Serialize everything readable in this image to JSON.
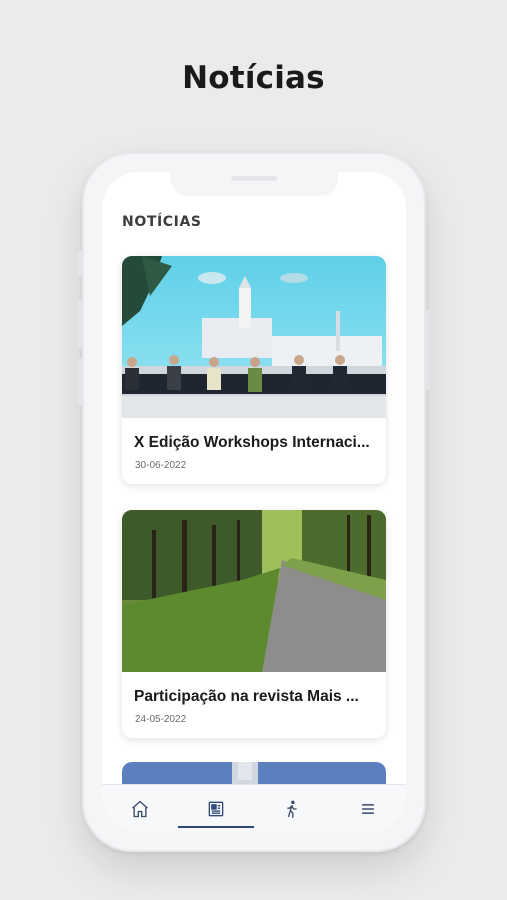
{
  "promo": {
    "title": "Notícias"
  },
  "screen": {
    "section_title": "NOTÍCIAS",
    "articles": [
      {
        "title": "X Edição Workshops Internaci...",
        "date": "30-06-2022"
      },
      {
        "title": "Participação na revista Mais ...",
        "date": "24-05-2022"
      }
    ]
  },
  "tabbar": {
    "tabs": [
      {
        "icon": "home-icon",
        "active": false
      },
      {
        "icon": "news-icon",
        "active": true
      },
      {
        "icon": "walking-person-icon",
        "active": false
      },
      {
        "icon": "menu-icon",
        "active": false
      }
    ]
  },
  "colors": {
    "accent": "#2f4a7a",
    "background": "#ebebea"
  }
}
